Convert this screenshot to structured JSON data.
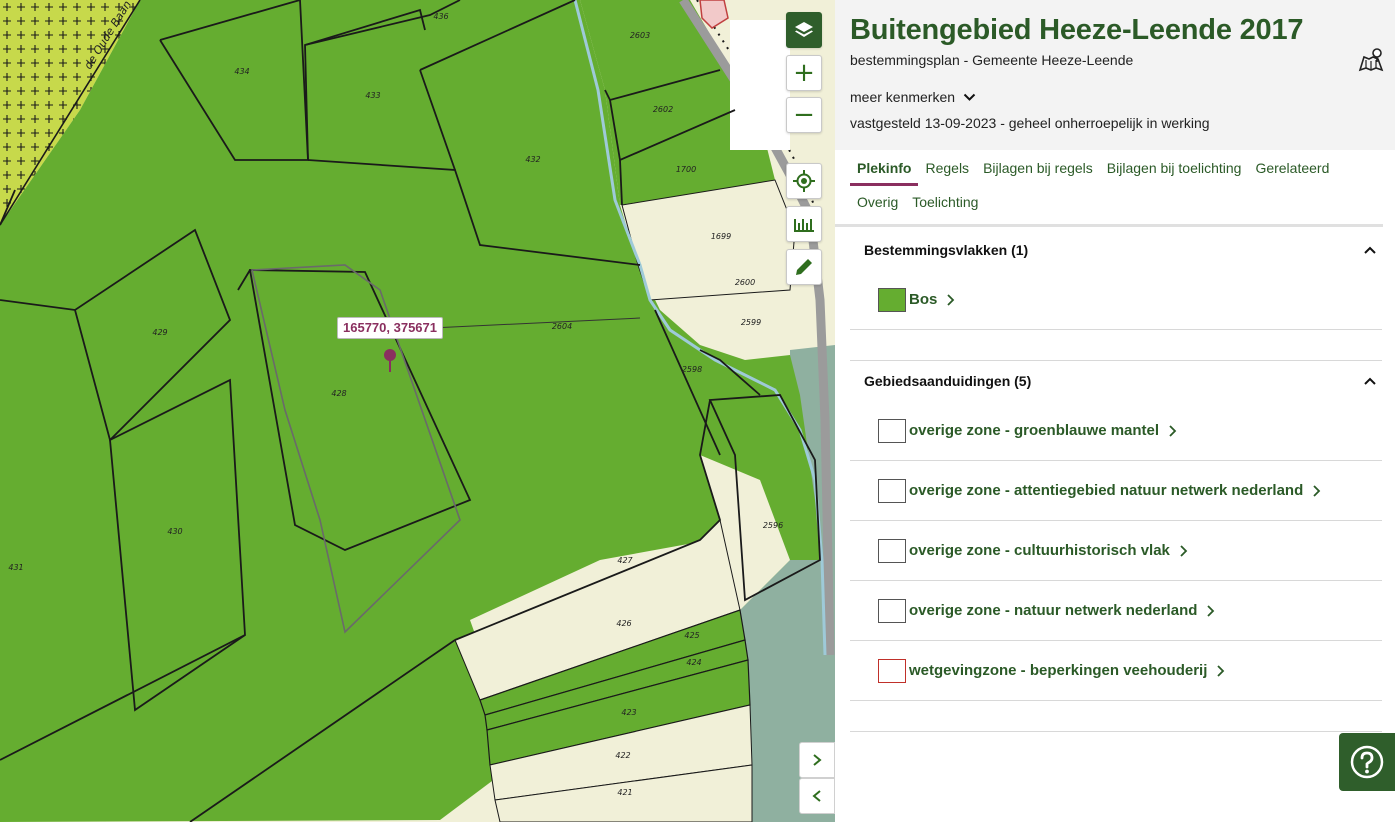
{
  "plan": {
    "title": "Buitengebied Heeze-Leende 2017",
    "subtitle": "bestemmingsplan - Gemeente Heeze-Leende",
    "more_label": "meer kenmerken",
    "status": "vastgesteld 13-09-2023 - geheel onherroepelijk in werking"
  },
  "tabs": [
    {
      "label": "Plekinfo",
      "active": true
    },
    {
      "label": "Regels"
    },
    {
      "label": "Bijlagen bij regels"
    },
    {
      "label": "Bijlagen bij toelichting"
    },
    {
      "label": "Gerelateerd"
    },
    {
      "label": "Overig"
    },
    {
      "label": "Toelichting"
    }
  ],
  "sections": {
    "bestemmingsvlakken": {
      "title": "Bestemmingsvlakken (1)",
      "items": [
        {
          "label": "Bos",
          "swatch_fill": "#65ad30",
          "swatch_border": "#555555"
        }
      ]
    },
    "gebiedsaanduidingen": {
      "title": "Gebiedsaanduidingen (5)",
      "items": [
        {
          "label": "overige zone - groenblauwe mantel",
          "swatch_fill": "#ffffff",
          "swatch_border": "#555555"
        },
        {
          "label": "overige zone - attentiegebied natuur netwerk nederland",
          "swatch_fill": "#ffffff",
          "swatch_border": "#555555"
        },
        {
          "label": "overige zone - cultuurhistorisch vlak",
          "swatch_fill": "#ffffff",
          "swatch_border": "#555555"
        },
        {
          "label": "overige zone - natuur netwerk nederland",
          "swatch_fill": "#ffffff",
          "swatch_border": "#555555"
        },
        {
          "label": "wetgevingzone - beperkingen veehouderij",
          "swatch_fill": "#ffffff",
          "swatch_border": "#c0302a"
        }
      ]
    }
  },
  "map": {
    "coordinate_label": "165770, 375671",
    "street_name": "de Oude Baan",
    "parcel_numbers": [
      "436",
      "434",
      "433",
      "432",
      "2603",
      "2602",
      "1700",
      "1699",
      "2600",
      "2599",
      "2604",
      "429",
      "428",
      "2598",
      "430",
      "2596",
      "431",
      "427",
      "426",
      "425",
      "424",
      "423",
      "422",
      "421"
    ],
    "controls": [
      "layers-icon",
      "zoom-in-icon",
      "zoom-out-icon",
      "locate-icon",
      "measure-icon",
      "draw-icon"
    ],
    "colors": {
      "forest": "#65ad30",
      "meadow": "#f1f0d8",
      "nature": "#c7d94b",
      "water": "#8fb0a0",
      "accent": "#8a2f5f",
      "brand": "#2f5e2b"
    }
  }
}
